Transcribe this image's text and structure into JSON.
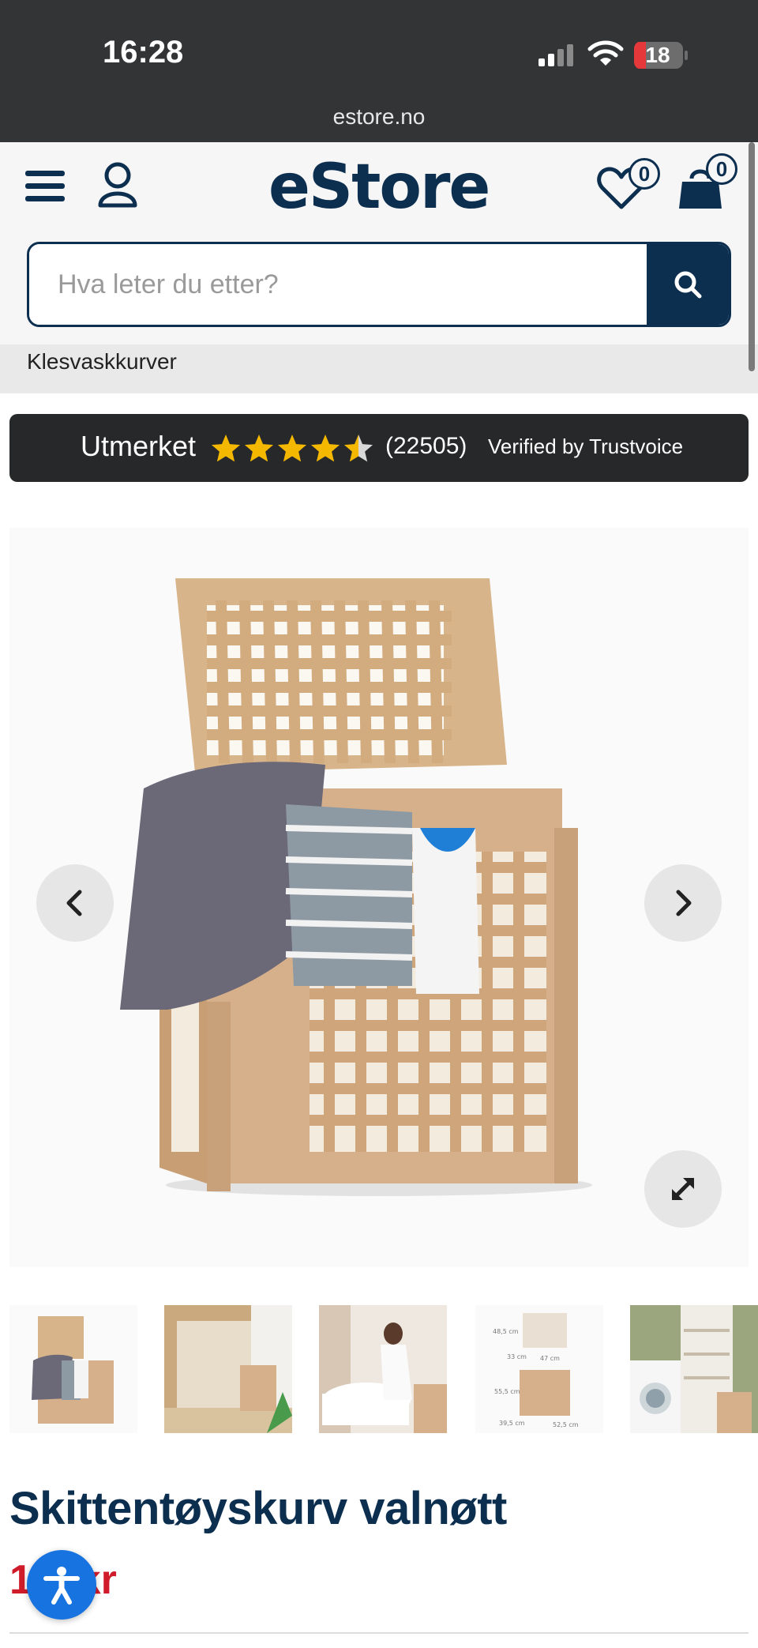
{
  "status_bar": {
    "time": "16:28",
    "battery": "18",
    "url": "estore.no"
  },
  "header": {
    "logo": "eStore",
    "wishlist_count": "0",
    "cart_count": "0",
    "search_placeholder": "Hva leter du etter?"
  },
  "breadcrumb": "Klesvaskkurver",
  "trust": {
    "rating_word": "Utmerket",
    "rating_stars": 4.5,
    "review_count": "(22505)",
    "verified": "Verified by Trustvoice"
  },
  "gallery": {
    "thumbnails": [
      "laundry-basket-front",
      "bathroom-scene",
      "woman-bathtub-scene",
      "dimension-drawing",
      "laundry-room-scene"
    ],
    "dimensions": [
      "48,5 cm",
      "33 cm",
      "47 cm",
      "55,5 cm",
      "39,5 cm",
      "52,5 cm"
    ]
  },
  "product": {
    "title": "Skittentøyskurv valnøtt",
    "price": "1 9 kr"
  },
  "colors": {
    "brand": "#0d2f4f",
    "price": "#d01c2a",
    "accessibility": "#1673e0",
    "star": "#f5b800"
  },
  "icons": [
    "menu-icon",
    "user-icon",
    "heart-icon",
    "cart-icon",
    "search-icon",
    "star-icon",
    "chevron-left-icon",
    "chevron-right-icon",
    "expand-icon",
    "accessibility-icon"
  ]
}
